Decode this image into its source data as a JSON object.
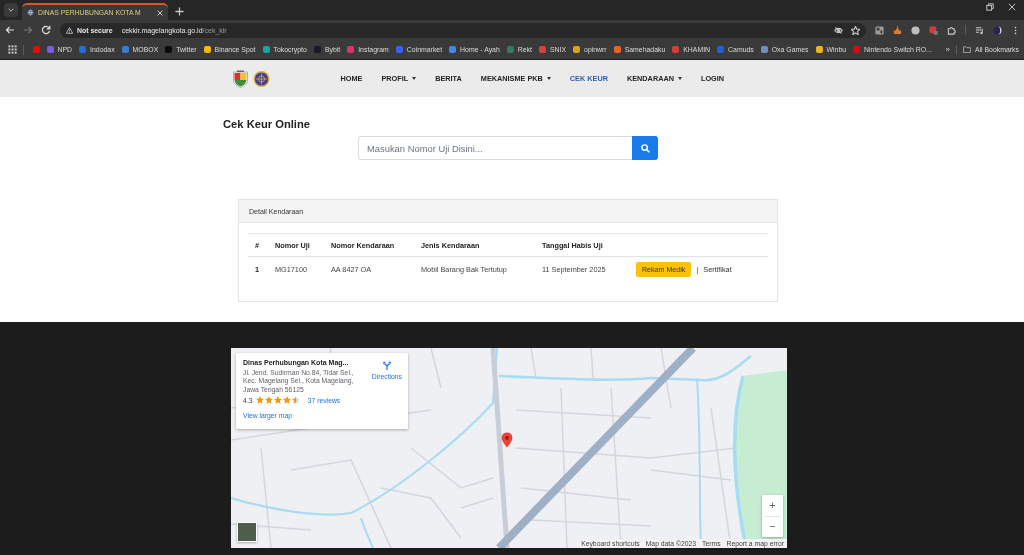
{
  "browser": {
    "tabs": [
      {
        "title": "DINAS PERHUBUNGAN KOTA M",
        "selected": true
      }
    ],
    "address_bar": {
      "security": "Not secure",
      "host": "cekkir.magelangkota.go.id",
      "path": "/cek_kir"
    },
    "bookmarks": [
      {
        "kind": "icon",
        "color": "#ff0000"
      },
      {
        "kind": "link",
        "label": "NPD",
        "color": "#7c5ce0"
      },
      {
        "kind": "link",
        "label": "Indodax",
        "color": "#1e6fd9"
      },
      {
        "kind": "link",
        "label": "MOBOX",
        "color": "#3a7bd5"
      },
      {
        "kind": "link",
        "label": "Twitter",
        "color": "#0a0a0a"
      },
      {
        "kind": "link",
        "label": "Binance Spot",
        "color": "#f0b90b"
      },
      {
        "kind": "link",
        "label": "Tokocrypto",
        "color": "#1aa39a"
      },
      {
        "kind": "link",
        "label": "Bybit",
        "color": "#15192a"
      },
      {
        "kind": "link",
        "label": "Instagram",
        "color": "#e1306c"
      },
      {
        "kind": "link",
        "label": "Coinmarket",
        "color": "#3861fb"
      },
      {
        "kind": "link",
        "label": "Home - Ayah",
        "color": "#4285f4"
      },
      {
        "kind": "link",
        "label": "Rekt",
        "color": "#2e7d5b"
      },
      {
        "kind": "link",
        "label": "SNIX",
        "color": "#d9413a"
      },
      {
        "kind": "link",
        "label": "opinwrr",
        "color": "#d9a21b"
      },
      {
        "kind": "link",
        "label": "Samehadaku",
        "color": "#e8632b"
      },
      {
        "kind": "link",
        "label": "KHAMIN",
        "color": "#d93a3a"
      },
      {
        "kind": "link",
        "label": "Camuds",
        "color": "#1e63d6"
      },
      {
        "kind": "link",
        "label": "Oxa Games",
        "color": "#6b8fc6"
      },
      {
        "kind": "link",
        "label": "Winbu",
        "color": "#e6b81f"
      },
      {
        "kind": "link",
        "label": "Nintendo Switch RO...",
        "color": "#e60012"
      }
    ],
    "bookmarks_overflow": "»",
    "all_bookmarks": "All Bookmarks"
  },
  "navbar": {
    "items": [
      {
        "label": "HOME",
        "selected": false,
        "dropdown": false
      },
      {
        "label": "PROFIL",
        "selected": false,
        "dropdown": true
      },
      {
        "label": "BERITA",
        "selected": false,
        "dropdown": false
      },
      {
        "label": "MEKANISME PKB",
        "selected": false,
        "dropdown": true
      },
      {
        "label": "CEK KEUR",
        "selected": true,
        "dropdown": false
      },
      {
        "label": "KENDARAAN",
        "selected": false,
        "dropdown": true
      },
      {
        "label": "LOGIN",
        "selected": false,
        "dropdown": false
      }
    ]
  },
  "page": {
    "title": "Cek Keur Online",
    "search": {
      "placeholder": "Masukan Nomor Uji Disini..."
    }
  },
  "vehicle_card": {
    "title": "Detail Kendaraan",
    "columns": [
      "#",
      "Nomor Uji",
      "Nomor Kendaraan",
      "Jenis Kendaraan",
      "Tanggal Habis Uji"
    ],
    "rows": [
      {
        "cells": [
          "1",
          "MG17100",
          "AA 8427 OA",
          "Mobil Barang Bak Tertutup",
          "11 September 2025"
        ],
        "actions": [
          {
            "kind": "button",
            "label": "Rekam Medik"
          },
          {
            "kind": "separator",
            "label": "|"
          },
          {
            "kind": "link",
            "label": "Sertifikat"
          }
        ]
      }
    ]
  },
  "map": {
    "place_card": {
      "name": "Dinas Perhubungan Kota Mag...",
      "address": "Jl. Jend. Sudirman No.84, Tidar Sel., Kec. Magelang Sel., Kota Magelang, Jawa Tengah 56125",
      "rating": "4.3",
      "stars": 4.5,
      "reviews": "37 reviews",
      "larger_map": "View larger map",
      "directions": "Directions"
    },
    "zoom": {
      "in": "+",
      "out": "−"
    },
    "attribution": [
      "Keyboard shortcuts",
      "Map data ©2023",
      "Terms",
      "Report a map error"
    ]
  }
}
